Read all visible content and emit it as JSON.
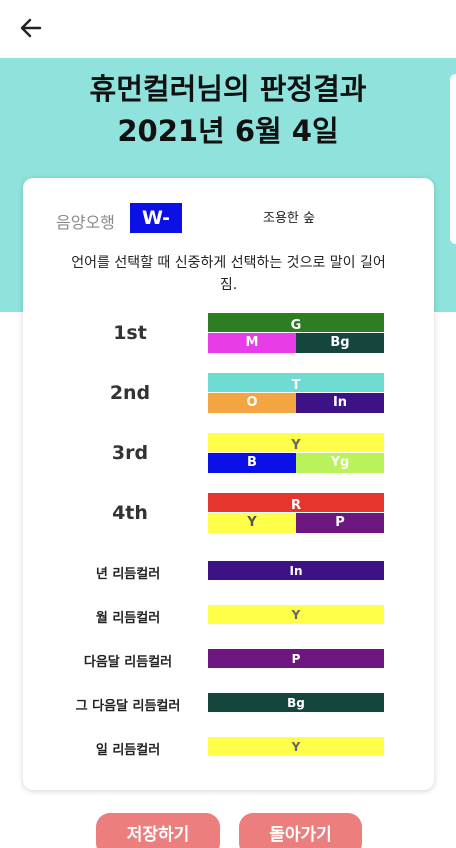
{
  "header": {
    "back_icon": "arrow-left-icon"
  },
  "title": {
    "line1": "휴먼컬러님의 판정결과",
    "line2": "2021년 6월 4일"
  },
  "ohang": {
    "label": "음양오행",
    "badge": "W-",
    "badge_color": "#0a10e6",
    "nickname": "조용한 숲"
  },
  "description": "언어를 선택할 때 신중하게 선택하는 것으로 말이 길어\n짐.",
  "ranks": [
    {
      "label": "1st",
      "top": {
        "code": "G",
        "color": "#2e7d22",
        "text_color": "#ffffff"
      },
      "left": {
        "code": "M",
        "color": "#e83ce8",
        "text_color": "#ffffff"
      },
      "right": {
        "code": "Bg",
        "color": "#14463e",
        "text_color": "#ffffff"
      }
    },
    {
      "label": "2nd",
      "top": {
        "code": "T",
        "color": "#6fdcd3",
        "text_color": "#ffffff"
      },
      "left": {
        "code": "O",
        "color": "#f2a540",
        "text_color": "#ffffff"
      },
      "right": {
        "code": "In",
        "color": "#3d1287",
        "text_color": "#ffffff"
      }
    },
    {
      "label": "3rd",
      "top": {
        "code": "Y",
        "color": "#ffff4a",
        "text_color": "#666666"
      },
      "left": {
        "code": "B",
        "color": "#0a10e6",
        "text_color": "#ffffff"
      },
      "right": {
        "code": "Yg",
        "color": "#b9f25a",
        "text_color": "#ffffff"
      }
    },
    {
      "label": "4th",
      "top": {
        "code": "R",
        "color": "#e8352c",
        "text_color": "#ffffff"
      },
      "left": {
        "code": "Y",
        "color": "#ffff4a",
        "text_color": "#555555"
      },
      "right": {
        "code": "P",
        "color": "#6e1680",
        "text_color": "#ffffff"
      }
    }
  ],
  "rhythms": [
    {
      "label": "년 리듬컬러",
      "code": "In",
      "color": "#3d1287",
      "text_color": "#ffffff"
    },
    {
      "label": "월 리듬컬러",
      "code": "Y",
      "color": "#ffff4a",
      "text_color": "#666666"
    },
    {
      "label": "다음달 리듬컬러",
      "code": "P",
      "color": "#6e1680",
      "text_color": "#ffffff"
    },
    {
      "label": "그 다음달 리듬컬러",
      "code": "Bg",
      "color": "#14463e",
      "text_color": "#ffffff"
    },
    {
      "label": "일 리듬컬러",
      "code": "Y",
      "color": "#ffff4a",
      "text_color": "#666666"
    }
  ],
  "buttons": {
    "save": "저장하기",
    "back": "돌아가기",
    "color": "#ec7e7e"
  }
}
